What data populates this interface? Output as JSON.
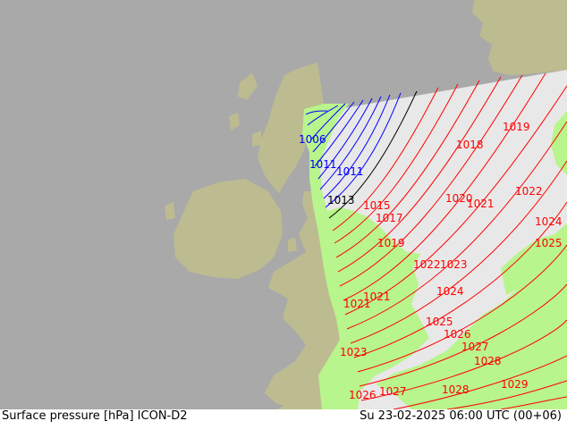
{
  "footer": {
    "title": "Surface pressure [hPa] ICON-D2",
    "valid_time": "Su 23-02-2025 06:00 UTC (00+06)"
  },
  "colors": {
    "background": "#a9a9a9",
    "land_outside": "#bdbc90",
    "sea_domain": "#e8e8e8",
    "land_domain": "#b8f58c",
    "isobar_low": "#0000ff",
    "isobar_mid": "#000000",
    "isobar_high": "#ff0000"
  },
  "isobar_labels": [
    {
      "text": "1006",
      "color": "blue"
    },
    {
      "text": "1011",
      "color": "blue"
    },
    {
      "text": "1011",
      "color": "blue"
    },
    {
      "text": "1013",
      "color": "black"
    },
    {
      "text": "1015",
      "color": "red"
    },
    {
      "text": "1017",
      "color": "red"
    },
    {
      "text": "1018",
      "color": "red"
    },
    {
      "text": "1019",
      "color": "red"
    },
    {
      "text": "1019",
      "color": "red"
    },
    {
      "text": "1020",
      "color": "red"
    },
    {
      "text": "1021",
      "color": "red"
    },
    {
      "text": "1021",
      "color": "red"
    },
    {
      "text": "1021",
      "color": "red"
    },
    {
      "text": "1022",
      "color": "red"
    },
    {
      "text": "1022",
      "color": "red"
    },
    {
      "text": "1023",
      "color": "red"
    },
    {
      "text": "1023",
      "color": "red"
    },
    {
      "text": "1024",
      "color": "red"
    },
    {
      "text": "1024",
      "color": "red"
    },
    {
      "text": "1025",
      "color": "red"
    },
    {
      "text": "1025",
      "color": "red"
    },
    {
      "text": "1026",
      "color": "red"
    },
    {
      "text": "1026",
      "color": "red"
    },
    {
      "text": "1027",
      "color": "red"
    },
    {
      "text": "1027",
      "color": "red"
    },
    {
      "text": "1028",
      "color": "red"
    },
    {
      "text": "1028",
      "color": "red"
    },
    {
      "text": "1029",
      "color": "red"
    }
  ]
}
